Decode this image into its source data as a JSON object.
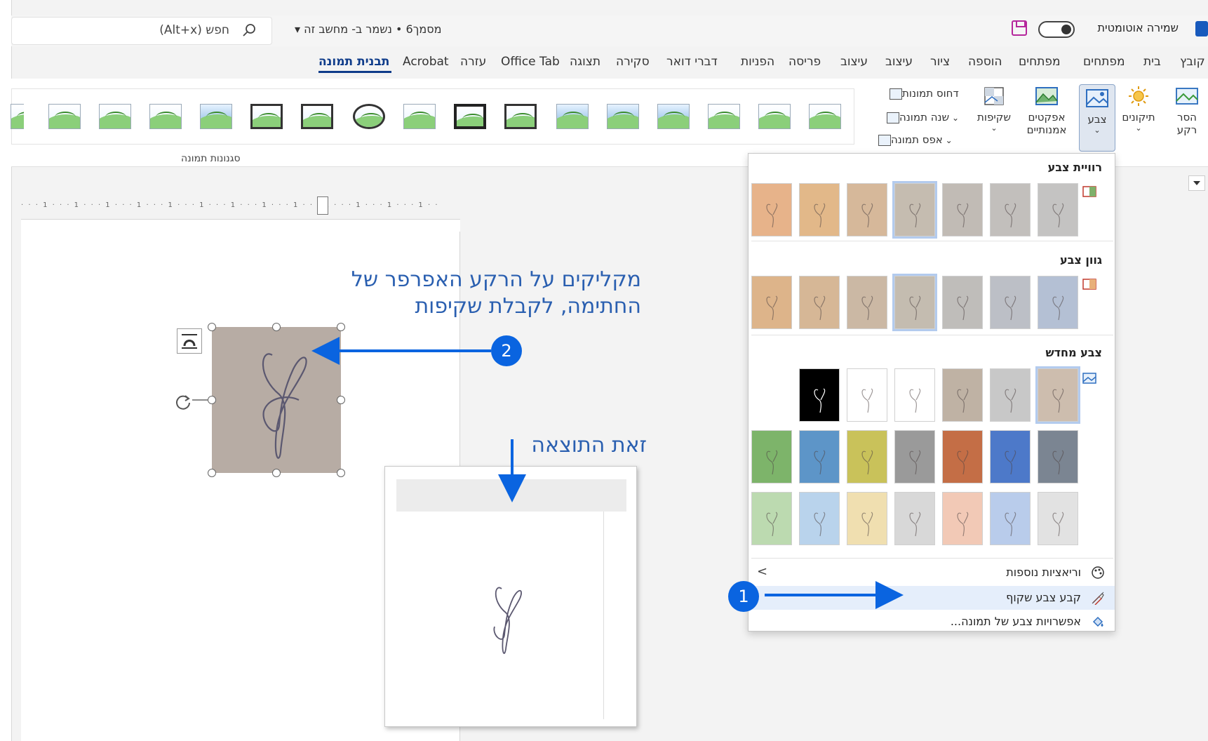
{
  "titlebar": {
    "search_text": "חפש (Alt+x)",
    "doc_title": "מסמך6 • נשמר ב- מחשב זה ▾",
    "autosave_label": "שמירה אוטומטית"
  },
  "tabs": [
    {
      "label": "קובץ"
    },
    {
      "label": "בית"
    },
    {
      "label": "מפתחים"
    },
    {
      "label": "מפתחים"
    },
    {
      "label": "הוספה"
    },
    {
      "label": "ציור"
    },
    {
      "label": "עיצוב"
    },
    {
      "label": "עיצוב"
    },
    {
      "label": "פריסה"
    },
    {
      "label": "הפניות"
    },
    {
      "label": "דברי דואר"
    },
    {
      "label": "סקירה"
    },
    {
      "label": "תצוגה"
    },
    {
      "label": "Office Tab"
    },
    {
      "label": "עזרה"
    },
    {
      "label": "Acrobat"
    },
    {
      "label": "תבנית תמונה"
    }
  ],
  "ribbon": {
    "remove_bg": {
      "line1": "הסר",
      "line2": "רקע"
    },
    "corrections": "תיקונים",
    "color": "צבע",
    "artistic": {
      "line1": "אפקטים",
      "line2": "אמנותיים"
    },
    "transparency": "שקיפות",
    "compress": "דחוס תמונות",
    "change_picture": "שנה תמונה",
    "reset_picture": "אפס תמונה",
    "styles_group_label": "סגנונות תמונה"
  },
  "color_panel": {
    "saturation_title": "רוויית צבע",
    "tone_title": "גוון צבע",
    "recolor_title": "צבע מחדש",
    "more_variations": "וריאציות נוספות",
    "set_transparent": "קבע צבע שקוף",
    "picture_color_options": "אפשרויות צבע של תמונה...",
    "saturation_colors": [
      "#e7b38a",
      "#e2b889",
      "#d6b89a",
      "#c5bcb0",
      "#c1bbb5",
      "#c2bfbc",
      "#c4c3c2"
    ],
    "tone_colors": [
      "#ddb48a",
      "#d6b796",
      "#cbb8a4",
      "#c4bcb0",
      "#bfbdba",
      "#bcbfc6",
      "#b4c0d4"
    ],
    "recolor_row1": [
      "#000000",
      "#ffffff",
      "#ffffff",
      "#bfb2a4",
      "#c8c8c8",
      "#cdbdae"
    ],
    "recolor_row2": [
      "#7db46a",
      "#5d95c8",
      "#c9c25a",
      "#9a9a9a",
      "#c46e46",
      "#4d79c9",
      "#7b8592"
    ],
    "recolor_row3": [
      "#bcdab0",
      "#b9d3ec",
      "#f0dfb0",
      "#d8d8d8",
      "#f2c9b6",
      "#b9cceb",
      "#e2e2e2"
    ]
  },
  "annotations": {
    "step2_line1": "מקליקים על הרקע האפרפר של",
    "step2_line2": "החתימה, לקבלת שקיפות",
    "result": "זאת התוצאה",
    "badge1": "1",
    "badge2": "2"
  },
  "colors": {
    "accent_blue": "#0a64e0",
    "annotation_text": "#2a5fb0",
    "active_tab": "#0f3c8a",
    "signature_bg": "#b7aca4"
  }
}
